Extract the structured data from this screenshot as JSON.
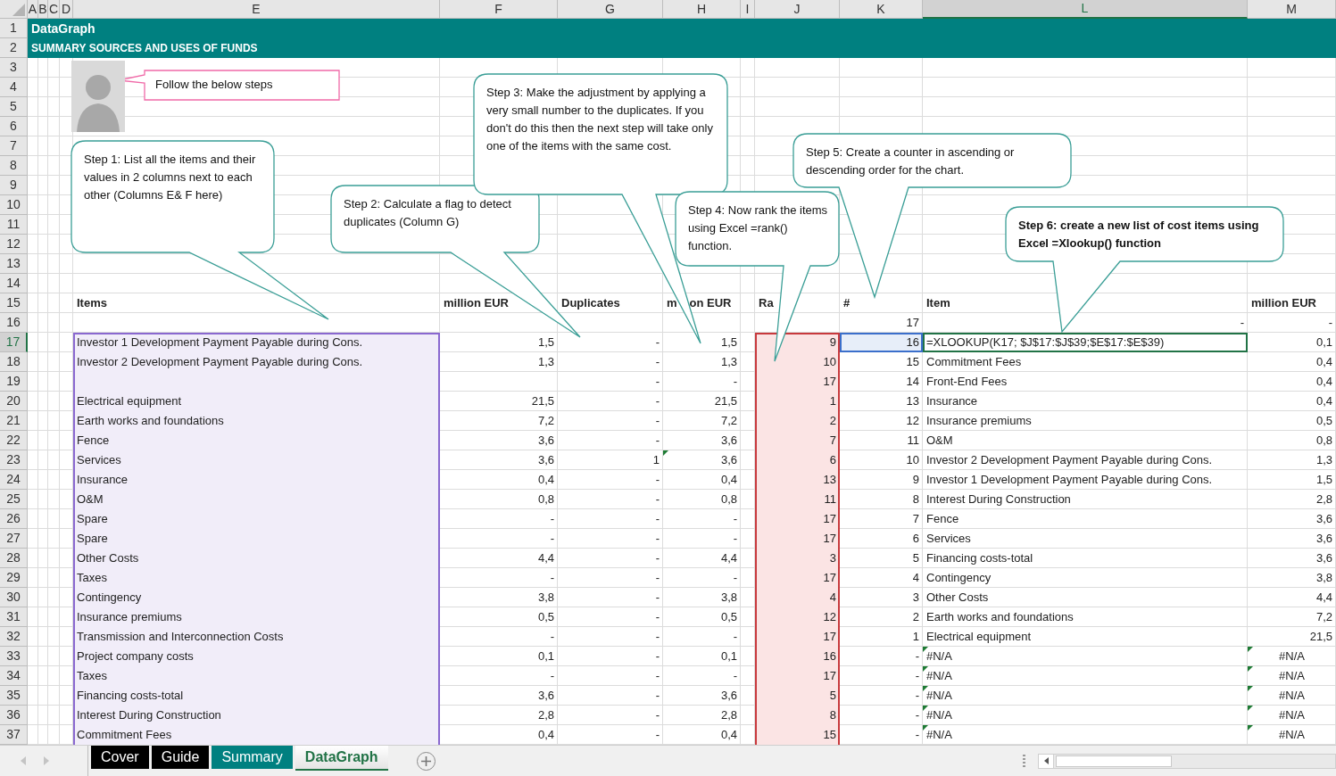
{
  "columns": [
    {
      "label": "A",
      "selected": false
    },
    {
      "label": "B",
      "selected": false
    },
    {
      "label": "C",
      "selected": false
    },
    {
      "label": "D",
      "selected": false
    },
    {
      "label": "E",
      "selected": false
    },
    {
      "label": "F",
      "selected": false
    },
    {
      "label": "G",
      "selected": false
    },
    {
      "label": "H",
      "selected": false
    },
    {
      "label": "I",
      "selected": false
    },
    {
      "label": "J",
      "selected": false
    },
    {
      "label": "K",
      "selected": false
    },
    {
      "label": "L",
      "selected": true
    },
    {
      "label": "M",
      "selected": false
    }
  ],
  "row_headers": [
    {
      "label": "1",
      "selected": false
    },
    {
      "label": "2",
      "selected": false
    },
    {
      "label": "3",
      "selected": false
    },
    {
      "label": "4",
      "selected": false
    },
    {
      "label": "5",
      "selected": false
    },
    {
      "label": "6",
      "selected": false
    },
    {
      "label": "7",
      "selected": false
    },
    {
      "label": "8",
      "selected": false
    },
    {
      "label": "9",
      "selected": false
    },
    {
      "label": "10",
      "selected": false
    },
    {
      "label": "11",
      "selected": false
    },
    {
      "label": "12",
      "selected": false
    },
    {
      "label": "13",
      "selected": false
    },
    {
      "label": "14",
      "selected": false
    },
    {
      "label": "15",
      "selected": false
    },
    {
      "label": "16",
      "selected": false
    },
    {
      "label": "17",
      "selected": true
    },
    {
      "label": "18",
      "selected": false
    },
    {
      "label": "19",
      "selected": false
    },
    {
      "label": "20",
      "selected": false
    },
    {
      "label": "21",
      "selected": false
    },
    {
      "label": "22",
      "selected": false
    },
    {
      "label": "23",
      "selected": false
    },
    {
      "label": "24",
      "selected": false
    },
    {
      "label": "25",
      "selected": false
    },
    {
      "label": "26",
      "selected": false
    },
    {
      "label": "27",
      "selected": false
    },
    {
      "label": "28",
      "selected": false
    },
    {
      "label": "29",
      "selected": false
    },
    {
      "label": "30",
      "selected": false
    },
    {
      "label": "31",
      "selected": false
    },
    {
      "label": "32",
      "selected": false
    },
    {
      "label": "33",
      "selected": false
    },
    {
      "label": "34",
      "selected": false
    },
    {
      "label": "35",
      "selected": false
    },
    {
      "label": "36",
      "selected": false
    },
    {
      "label": "37",
      "selected": false
    }
  ],
  "banner": {
    "title": "DataGraph",
    "subtitle": "SUMMARY SOURCES AND USES OF FUNDS"
  },
  "callouts": [
    {
      "kind": "note",
      "text": "Follow the below steps",
      "bold": false
    },
    {
      "kind": "step",
      "text": "Step 1: List all the items and their values in 2 columns next to each other (Columns E& F here)",
      "bold": false
    },
    {
      "kind": "step",
      "text": "Step 2: Calculate a flag to detect duplicates (Column G)",
      "bold": false
    },
    {
      "kind": "step",
      "text": "Step 3: Make the adjustment by applying a very small number to the duplicates. If you don't do this then the next step will take only one of the items with the same cost.",
      "bold": false
    },
    {
      "kind": "step",
      "text": "Step 4: Now rank the items using Excel =rank() function.",
      "bold": false
    },
    {
      "kind": "step",
      "text": "Step 5: Create a counter in ascending or descending order for the chart.",
      "bold": false
    },
    {
      "kind": "step",
      "text": "Step 6: create a new list of cost items using Excel =Xlookup() function",
      "bold": true
    }
  ],
  "table": {
    "editing": true,
    "headers": {
      "item": "Items",
      "value": "million EUR",
      "duplicate": "Duplicates",
      "adjusted_parts": [
        "m",
        "on EUR"
      ],
      "rank": "Ra",
      "counter": "#",
      "lookup": "Item",
      "lookup_value": "million EUR"
    },
    "first_row": {
      "counter": "17",
      "lookup": "-",
      "lookup_value": "-"
    },
    "rows": [
      {
        "item": "Investor 1 Development Payment Payable during Cons.",
        "value": "1,5",
        "duplicate": "-",
        "adjusted": "1,5",
        "rank": "9",
        "counter": "16",
        "lookup": "=XLOOKUP(K17; $J$17:$J$39;$E$17:$E$39)",
        "lookup_value": "0,1",
        "kind": "formula",
        "warning": false
      },
      {
        "item": "Investor 2 Development Payment Payable during Cons.",
        "value": "1,3",
        "duplicate": "-",
        "adjusted": "1,3",
        "rank": "10",
        "counter": "15",
        "lookup": "Commitment Fees",
        "lookup_value": "0,4",
        "kind": "text",
        "warning": false
      },
      {
        "duplicate": "-",
        "adjusted": "-",
        "rank": "17",
        "counter": "14",
        "lookup": "Front-End Fees",
        "lookup_value": "0,4",
        "kind": "text",
        "warning": false
      },
      {
        "item": "Electrical equipment",
        "value": "21,5",
        "duplicate": "-",
        "adjusted": "21,5",
        "rank": "1",
        "counter": "13",
        "lookup": "Insurance",
        "lookup_value": "0,4",
        "kind": "text",
        "warning": false
      },
      {
        "item": "Earth works and foundations",
        "value": "7,2",
        "duplicate": "-",
        "adjusted": "7,2",
        "rank": "2",
        "counter": "12",
        "lookup": "Insurance premiums",
        "lookup_value": "0,5",
        "kind": "text",
        "warning": false
      },
      {
        "item": "Fence",
        "value": "3,6",
        "duplicate": "-",
        "adjusted": "3,6",
        "rank": "7",
        "counter": "11",
        "lookup": "O&M",
        "lookup_value": "0,8",
        "kind": "text",
        "warning": false
      },
      {
        "item": "Services",
        "value": "3,6",
        "duplicate": "1",
        "adjusted": "3,6",
        "rank": "6",
        "counter": "10",
        "lookup": "Investor 2 Development Payment Payable during Cons.",
        "lookup_value": "1,3",
        "kind": "text",
        "warning": true
      },
      {
        "item": "Insurance",
        "value": "0,4",
        "duplicate": "-",
        "adjusted": "0,4",
        "rank": "13",
        "counter": "9",
        "lookup": "Investor 1 Development Payment Payable during Cons.",
        "lookup_value": "1,5",
        "kind": "text",
        "warning": false
      },
      {
        "item": "O&M",
        "value": "0,8",
        "duplicate": "-",
        "adjusted": "0,8",
        "rank": "11",
        "counter": "8",
        "lookup": "Interest During Construction",
        "lookup_value": "2,8",
        "kind": "text",
        "warning": false
      },
      {
        "item": "Spare",
        "value": "-",
        "duplicate": "-",
        "adjusted": "-",
        "rank": "17",
        "counter": "7",
        "lookup": "Fence",
        "lookup_value": "3,6",
        "kind": "text",
        "warning": false
      },
      {
        "item": "Spare",
        "value": "-",
        "duplicate": "-",
        "adjusted": "-",
        "rank": "17",
        "counter": "6",
        "lookup": "Services",
        "lookup_value": "3,6",
        "kind": "text",
        "warning": false
      },
      {
        "item": "Other Costs",
        "value": "4,4",
        "duplicate": "-",
        "adjusted": "4,4",
        "rank": "3",
        "counter": "5",
        "lookup": "Financing costs-total",
        "lookup_value": "3,6",
        "kind": "text",
        "warning": false
      },
      {
        "item": "Taxes",
        "value": "-",
        "duplicate": "-",
        "adjusted": "-",
        "rank": "17",
        "counter": "4",
        "lookup": "Contingency",
        "lookup_value": "3,8",
        "kind": "text",
        "warning": false
      },
      {
        "item": "Contingency",
        "value": "3,8",
        "duplicate": "-",
        "adjusted": "3,8",
        "rank": "4",
        "counter": "3",
        "lookup": "Other Costs",
        "lookup_value": "4,4",
        "kind": "text",
        "warning": false
      },
      {
        "item": "Insurance premiums",
        "value": "0,5",
        "duplicate": "-",
        "adjusted": "0,5",
        "rank": "12",
        "counter": "2",
        "lookup": "Earth works and foundations",
        "lookup_value": "7,2",
        "kind": "text",
        "warning": false
      },
      {
        "item": "Transmission and Interconnection Costs",
        "value": "-",
        "duplicate": "-",
        "adjusted": "-",
        "rank": "17",
        "counter": "1",
        "lookup": "Electrical equipment",
        "lookup_value": "21,5",
        "kind": "text",
        "warning": false
      },
      {
        "item": "Project company costs",
        "value": "0,1",
        "duplicate": "-",
        "adjusted": "0,1",
        "rank": "16",
        "counter": "-",
        "lookup": "#N/A",
        "lookup_value": "#N/A",
        "kind": "error",
        "warning": false
      },
      {
        "item": "Taxes",
        "value": "-",
        "duplicate": "-",
        "adjusted": "-",
        "rank": "17",
        "counter": "-",
        "lookup": "#N/A",
        "lookup_value": "#N/A",
        "kind": "error",
        "warning": false
      },
      {
        "item": "Financing costs-total",
        "value": "3,6",
        "duplicate": "-",
        "adjusted": "3,6",
        "rank": "5",
        "counter": "-",
        "lookup": "#N/A",
        "lookup_value": "#N/A",
        "kind": "error",
        "warning": false
      },
      {
        "item": "Interest During Construction",
        "value": "2,8",
        "duplicate": "-",
        "adjusted": "2,8",
        "rank": "8",
        "counter": "-",
        "lookup": "#N/A",
        "lookup_value": "#N/A",
        "kind": "error",
        "warning": false
      },
      {
        "item": "Commitment Fees",
        "value": "0,4",
        "duplicate": "-",
        "adjusted": "0,4",
        "rank": "15",
        "counter": "-",
        "lookup": "#N/A",
        "lookup_value": "#N/A",
        "kind": "error",
        "warning": false
      }
    ]
  },
  "sheet_tabs": [
    {
      "label": "Cover",
      "selected": false,
      "color": "#000000"
    },
    {
      "label": "Guide",
      "selected": false,
      "color": "#000000"
    },
    {
      "label": "Summary",
      "selected": false,
      "color": "#008080"
    },
    {
      "label": "DataGraph",
      "selected": true,
      "color": "#217346"
    }
  ]
}
